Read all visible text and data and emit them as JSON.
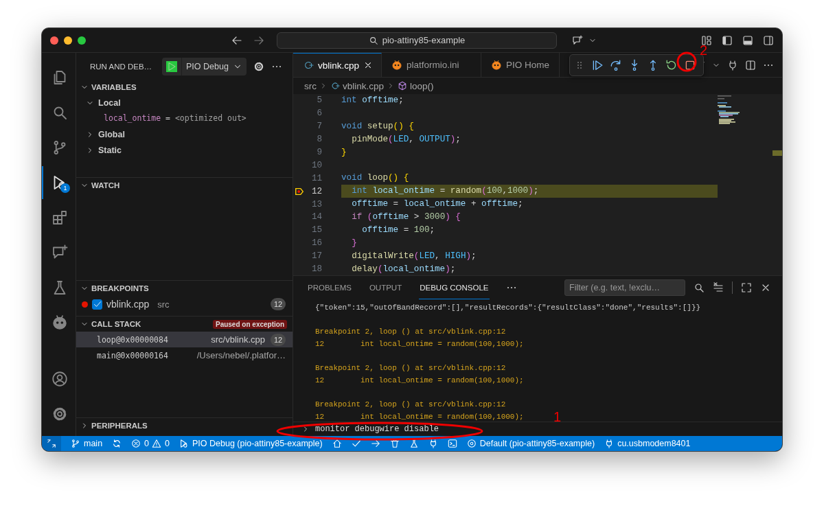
{
  "window": {
    "search": "pio-attiny85-example"
  },
  "activity_bar": [
    {
      "kind": "files",
      "selected": false
    },
    {
      "kind": "search",
      "selected": false
    },
    {
      "kind": "branch",
      "selected": false
    },
    {
      "kind": "debug",
      "selected": true,
      "badge": "1"
    },
    {
      "kind": "extensions",
      "selected": false
    },
    {
      "kind": "chat",
      "selected": false
    },
    {
      "kind": "flask",
      "selected": false
    },
    {
      "kind": "alien",
      "selected": false
    },
    {
      "kind": "account",
      "selected": false
    },
    {
      "kind": "settings",
      "selected": false
    }
  ],
  "sidebar": {
    "title": "RUN AND DEB…",
    "config": "PIO Debug",
    "variables": {
      "title": "VARIABLES",
      "expanded": true,
      "scopes": [
        {
          "label": "Local",
          "expanded": true,
          "vars": [
            {
              "name": "local_ontime",
              "separator": "=",
              "value": "<optimized out>"
            }
          ]
        },
        {
          "label": "Global",
          "expanded": false
        },
        {
          "label": "Static",
          "expanded": false
        }
      ]
    },
    "watch": {
      "title": "WATCH",
      "expanded": true
    },
    "breakpoints": {
      "title": "BREAKPOINTS",
      "expanded": true,
      "items": [
        {
          "file": "vblink.cpp",
          "folder": "src",
          "checked": true,
          "line": "12"
        }
      ]
    },
    "call_stack": {
      "title": "CALL STACK",
      "expanded": true,
      "badge": "Paused on exception",
      "frames": [
        {
          "name": "loop@0x00000084",
          "source": "src/vblink.cpp",
          "line": "12",
          "selected": true
        },
        {
          "name": "main@0x00000164",
          "source": "/Users/nebel/.platfor…",
          "selected": false
        }
      ]
    },
    "peripherals": {
      "title": "PERIPHERALS",
      "expanded": false
    }
  },
  "tabs": [
    {
      "label": "vblink.cpp",
      "kind": "cpp",
      "selected": true
    },
    {
      "label": "platformio.ini",
      "kind": "alien",
      "selected": false
    },
    {
      "label": "PIO Home",
      "kind": "alien",
      "selected": false
    }
  ],
  "debug_toolbar": [
    {
      "kind": "continue"
    },
    {
      "kind": "step-over"
    },
    {
      "kind": "step-into"
    },
    {
      "kind": "step-out"
    },
    {
      "kind": "restart"
    },
    {
      "kind": "stop"
    }
  ],
  "breadcrumb": [
    "src",
    "vblink.cpp",
    "loop()"
  ],
  "code": [
    {
      "number": "5",
      "current": false,
      "text": "int offtime;"
    },
    {
      "number": "6",
      "current": false
    },
    {
      "number": "7",
      "current": false,
      "text": "void setup() {"
    },
    {
      "number": "8",
      "current": false,
      "text": "  pinMode(LED, OUTPUT);"
    },
    {
      "number": "9",
      "current": false,
      "text": "}"
    },
    {
      "number": "10",
      "current": false
    },
    {
      "number": "11",
      "current": false,
      "text": "void loop() {"
    },
    {
      "number": "12",
      "current": true,
      "text": "  int local_ontime = random(100,1000);"
    },
    {
      "number": "13",
      "current": false,
      "text": "  offtime = local_ontime + offtime;"
    },
    {
      "number": "14",
      "current": false,
      "text": "  if (offtime > 3000) {"
    },
    {
      "number": "15",
      "current": false,
      "text": "    offtime = 100;"
    },
    {
      "number": "16",
      "current": false,
      "text": "  }"
    },
    {
      "number": "17",
      "current": false,
      "text": "  digitalWrite(LED, HIGH);"
    },
    {
      "number": "18",
      "current": false,
      "text": "  delay(local_ontime);"
    }
  ],
  "panel": {
    "tabs": [
      {
        "label": "PROBLEMS",
        "selected": false
      },
      {
        "label": "OUTPUT",
        "selected": false
      },
      {
        "label": "DEBUG CONSOLE",
        "selected": true
      }
    ],
    "filter": {
      "placeholder": "Filter (e.g. text, !exclu…"
    },
    "console": [
      [
        {
          "text": "{\"token\":15,\"outOfBandRecord\":[],\"resultRecords\":{\"resultClass\":\"done\",\"results\":[]}}",
          "kind": "log"
        }
      ],
      [
        {
          "text": "Breakpoint 2, loop () at src/vblink.cpp:12",
          "kind": "output"
        },
        {
          "text": "12        int local_ontime = random(100,1000);",
          "kind": "output"
        }
      ],
      [
        {
          "text": "Breakpoint 2, loop () at src/vblink.cpp:12",
          "kind": "output"
        },
        {
          "text": "12        int local_ontime = random(100,1000);",
          "kind": "output"
        }
      ],
      [
        {
          "text": "Breakpoint 2, loop () at src/vblink.cpp:12",
          "kind": "output"
        },
        {
          "text": "12        int local_ontime = random(100,1000);",
          "kind": "output"
        }
      ]
    ],
    "input": "monitor debugwire disable"
  },
  "status_bar": [
    {
      "kind": "remote"
    },
    {
      "kind": "branch",
      "text": "main"
    },
    {
      "kind": "sync"
    },
    {
      "kind": "error",
      "text": "0"
    },
    {
      "kind": "warning",
      "text": "0"
    },
    {
      "kind": "debug",
      "text": "PIO Debug (pio-attiny85-example)"
    },
    {
      "kind": "home"
    },
    {
      "kind": "check"
    },
    {
      "kind": "arrow"
    },
    {
      "kind": "trash"
    },
    {
      "kind": "flask"
    },
    {
      "kind": "plug"
    },
    {
      "kind": "terminal"
    },
    {
      "kind": "env",
      "text": "Default (pio-attiny85-example)"
    },
    {
      "kind": "plug",
      "text": "cu.usbmodem8401"
    }
  ],
  "annotations": [
    {
      "label": "1"
    },
    {
      "label": "2"
    }
  ]
}
